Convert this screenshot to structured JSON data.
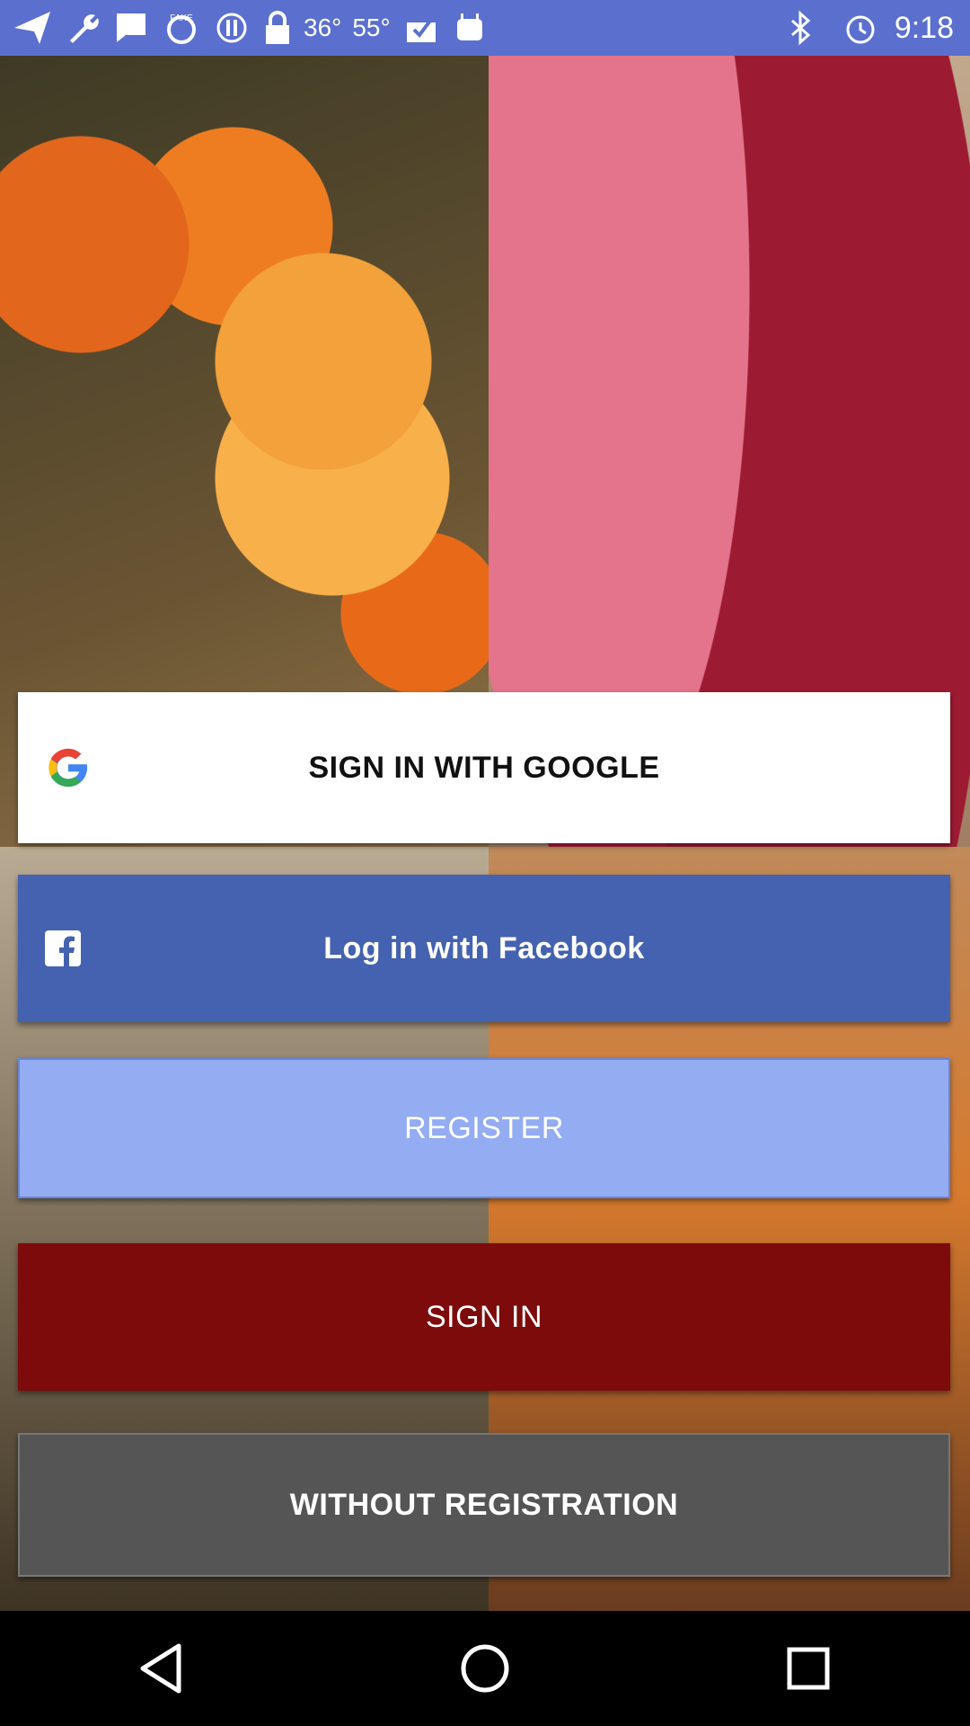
{
  "status_bar": {
    "temp1": "36°",
    "temp2": "55°",
    "time": "9:18",
    "icons": [
      "navigation-icon",
      "wrench-icon",
      "message-icon",
      "fake-gps-icon",
      "sync-icon",
      "lock-icon",
      "checkbox-icon",
      "android-icon",
      "bluetooth-icon",
      "alarm-icon"
    ]
  },
  "buttons": {
    "google_label": "SIGN IN WITH GOOGLE",
    "facebook_label": "Log in with Facebook",
    "register_label": "REGISTER",
    "signin_label": "SIGN IN",
    "without_label": "WITHOUT REGISTRATION"
  },
  "colors": {
    "status_bar": "#5b6fcf",
    "facebook": "#4462b0",
    "register": "#93acf2",
    "signin": "#7d0b0b",
    "without": "#555555"
  },
  "nav_bar": {
    "icons": [
      "back-icon",
      "home-icon",
      "recents-icon"
    ]
  }
}
